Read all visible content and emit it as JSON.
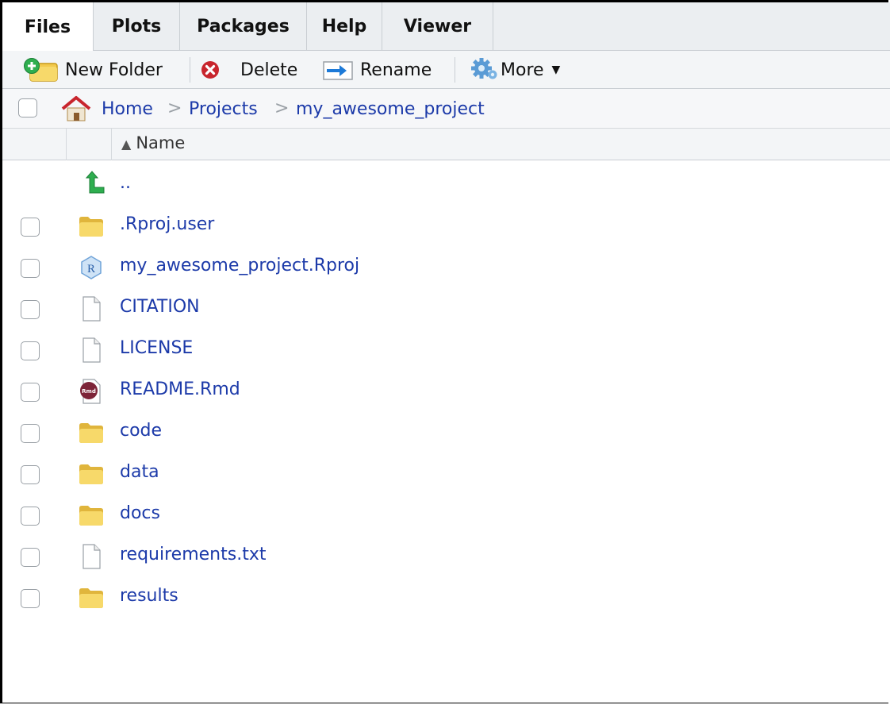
{
  "tabs": [
    {
      "label": "Files",
      "active": true
    },
    {
      "label": "Plots",
      "active": false
    },
    {
      "label": "Packages",
      "active": false
    },
    {
      "label": "Help",
      "active": false
    },
    {
      "label": "Viewer",
      "active": false
    }
  ],
  "toolbar": {
    "new_folder": {
      "label": "New Folder",
      "icon": "new-folder-icon"
    },
    "delete": {
      "label": "Delete",
      "icon": "delete-icon"
    },
    "rename": {
      "label": "Rename",
      "icon": "rename-icon"
    },
    "more": {
      "label": "More",
      "icon": "gear-icon"
    }
  },
  "breadcrumb": {
    "items": [
      "Home",
      "Projects",
      "my_awesome_project"
    ],
    "separator": ">"
  },
  "columns": {
    "name": "Name",
    "sort_indicator": "▲"
  },
  "files": {
    "parent": {
      "name": ".."
    },
    "items": [
      {
        "name": ".Rproj.user",
        "type": "folder"
      },
      {
        "name": "my_awesome_project.Rproj",
        "type": "rproj"
      },
      {
        "name": "CITATION",
        "type": "file"
      },
      {
        "name": "LICENSE",
        "type": "file"
      },
      {
        "name": "README.Rmd",
        "type": "rmd"
      },
      {
        "name": "code",
        "type": "folder"
      },
      {
        "name": "data",
        "type": "folder"
      },
      {
        "name": "docs",
        "type": "folder"
      },
      {
        "name": "requirements.txt",
        "type": "file"
      },
      {
        "name": "results",
        "type": "folder"
      }
    ]
  },
  "colors": {
    "link": "#1c3aa9",
    "folder": "#f2c94c",
    "up_arrow": "#2eae4f",
    "delete": "#c8252d",
    "home_roof": "#c8252d"
  }
}
